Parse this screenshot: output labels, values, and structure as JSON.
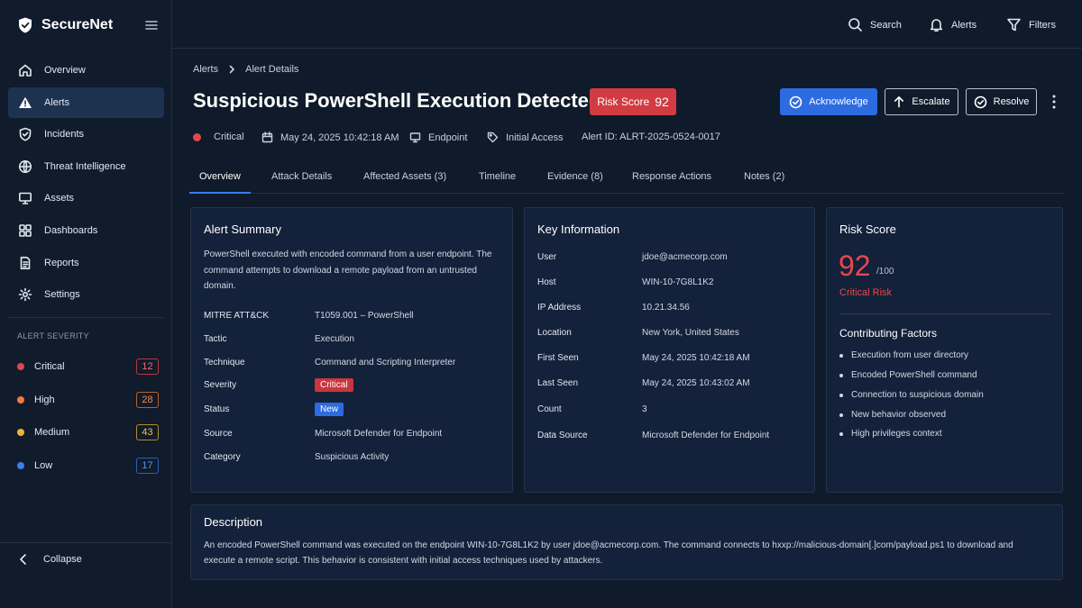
{
  "brand": {
    "name": "SecureNet",
    "icon": "shield-check-icon"
  },
  "sidebar": {
    "items": [
      {
        "label": "Overview",
        "icon": "home-icon"
      },
      {
        "label": "Alerts",
        "icon": "warning-icon"
      },
      {
        "label": "Incidents",
        "icon": "shield-icon"
      },
      {
        "label": "Threat Intelligence",
        "icon": "globe-icon"
      },
      {
        "label": "Assets",
        "icon": "monitor-icon"
      },
      {
        "label": "Dashboards",
        "icon": "grid-icon"
      },
      {
        "label": "Reports",
        "icon": "document-icon"
      },
      {
        "label": "Settings",
        "icon": "gear-icon"
      }
    ],
    "severity_title": "ALERT SEVERITY",
    "severity": [
      {
        "label": "Critical",
        "count": "12",
        "color": "#e0474c"
      },
      {
        "label": "High",
        "count": "28",
        "color": "#f07b3a"
      },
      {
        "label": "Medium",
        "count": "43",
        "color": "#f0b33a"
      },
      {
        "label": "Low",
        "count": "17",
        "color": "#3a7ff0"
      }
    ],
    "collapse_label": "Collapse"
  },
  "topbar": {
    "search": "Search",
    "alerts": "Alerts",
    "filters": "Filters"
  },
  "breadcrumb": {
    "parent": "Alerts",
    "current": "Alert Details"
  },
  "alert": {
    "title": "Suspicious PowerShell Execution Detected",
    "risk_label": "Risk Score",
    "risk_value": "92",
    "actions": {
      "acknowledge": "Acknowledge",
      "escalate": "Escalate",
      "resolve": "Resolve"
    },
    "meta": {
      "severity": "Critical",
      "datetime": "May 24, 2025 10:42:18 AM",
      "type": "Endpoint",
      "stage": "Initial Access",
      "alert_id": "Alert ID: ALRT-2025-0524-0017"
    }
  },
  "tabs": [
    "Overview",
    "Attack Details",
    "Affected Assets (3)",
    "Timeline",
    "Evidence (8)",
    "Response Actions",
    "Notes (2)"
  ],
  "summary": {
    "title": "Alert Summary",
    "text": "PowerShell executed with encoded command from a user endpoint. The command attempts to download a remote payload from an untrusted domain.",
    "rows": [
      {
        "key": "MITRE ATT&CK",
        "value": "T1059.001 – PowerShell"
      },
      {
        "key": "Tactic",
        "value": "Execution"
      },
      {
        "key": "Technique",
        "value": "Command and Scripting Interpreter"
      },
      {
        "key": "Severity",
        "value": "Critical"
      },
      {
        "key": "Status",
        "value": "New"
      },
      {
        "key": "Source",
        "value": "Microsoft Defender for Endpoint"
      },
      {
        "key": "Category",
        "value": "Suspicious Activity"
      }
    ]
  },
  "key_info": {
    "title": "Key Information",
    "rows": [
      {
        "key": "User",
        "value": "jdoe@acmecorp.com"
      },
      {
        "key": "Host",
        "value": "WIN-10-7G8L1K2"
      },
      {
        "key": "IP Address",
        "value": "10.21.34.56"
      },
      {
        "key": "Location",
        "value": "New York, United States"
      },
      {
        "key": "First Seen",
        "value": "May 24, 2025 10:42:18 AM"
      },
      {
        "key": "Last Seen",
        "value": "May 24, 2025 10:43:02 AM"
      },
      {
        "key": "Count",
        "value": "3"
      },
      {
        "key": "Data Source",
        "value": "Microsoft Defender for Endpoint"
      }
    ]
  },
  "risk": {
    "title": "Risk Score",
    "value": "92",
    "max": "/100",
    "level": "Critical Risk",
    "factors_title": "Contributing Factors",
    "factors": [
      "Execution from user directory",
      "Encoded PowerShell command",
      "Connection to suspicious domain",
      "New behavior observed",
      "High privileges context"
    ]
  },
  "description": {
    "title": "Description",
    "text": "An encoded PowerShell command was executed on the endpoint WIN-10-7G8L1K2 by user jdoe@acmecorp.com. The command connects to hxxp://malicious-domain[.]com/payload.ps1 to download and execute a remote script. This behavior is consistent with initial access techniques used by attackers."
  }
}
